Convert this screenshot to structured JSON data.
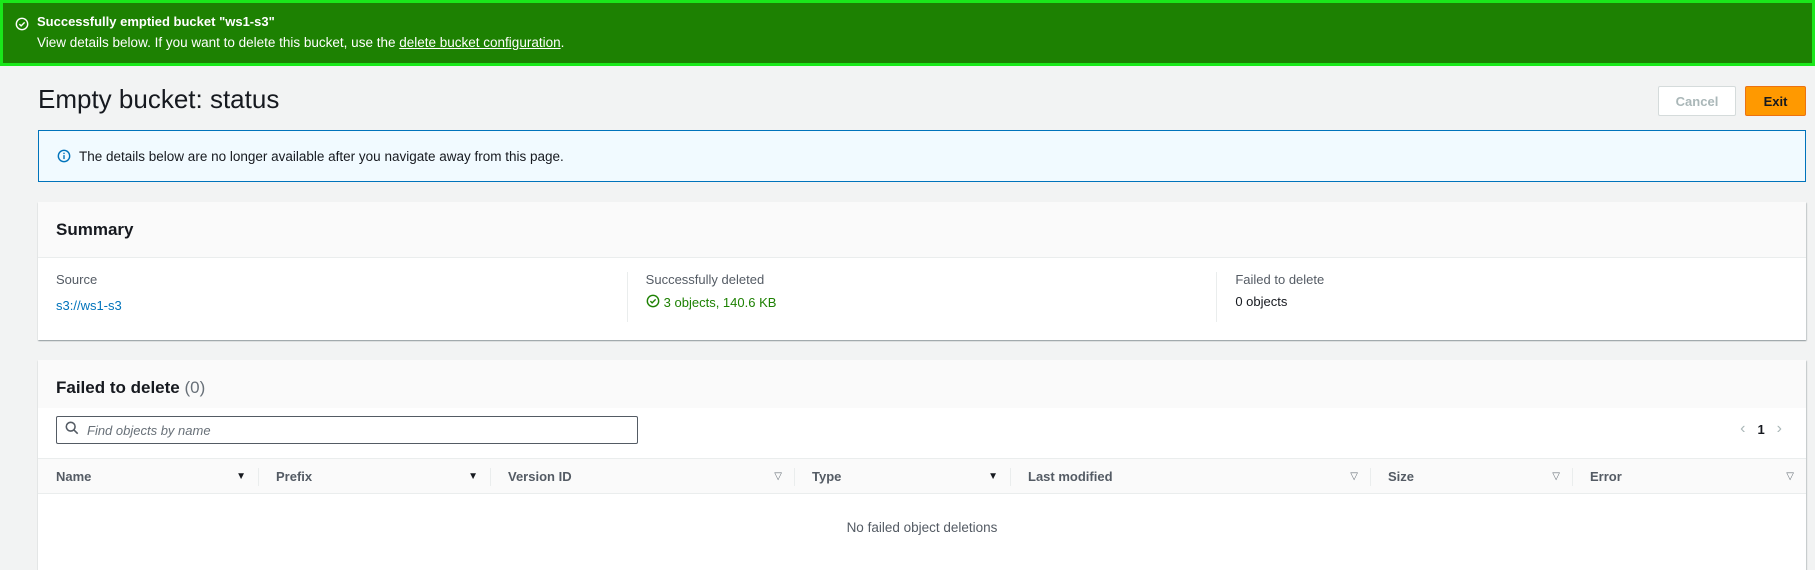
{
  "flash": {
    "title": "Successfully emptied bucket \"ws1-s3\"",
    "body_prefix": "View details below. If you want to delete this bucket, use the ",
    "link": "delete bucket configuration",
    "body_suffix": ".",
    "icon": "check-circle-icon",
    "color": "#1d8102"
  },
  "page": {
    "title": "Empty bucket: status"
  },
  "actions": {
    "cancel": "Cancel",
    "exit": "Exit"
  },
  "info": {
    "text": "The details below are no longer available after you navigate away from this page.",
    "icon": "info-icon"
  },
  "summary": {
    "title": "Summary",
    "source": {
      "label": "Source",
      "value": "s3://ws1-s3"
    },
    "deleted": {
      "label": "Successfully deleted",
      "value": "3 objects, 140.6 KB"
    },
    "failed": {
      "label": "Failed to delete",
      "value": "0 objects"
    }
  },
  "failed_table": {
    "title": "Failed to delete",
    "count": "(0)",
    "search_placeholder": "Find objects by name",
    "page": "1",
    "columns": [
      "Name",
      "Prefix",
      "Version ID",
      "Type",
      "Last modified",
      "Size",
      "Error"
    ],
    "empty_text": "No failed object deletions"
  }
}
